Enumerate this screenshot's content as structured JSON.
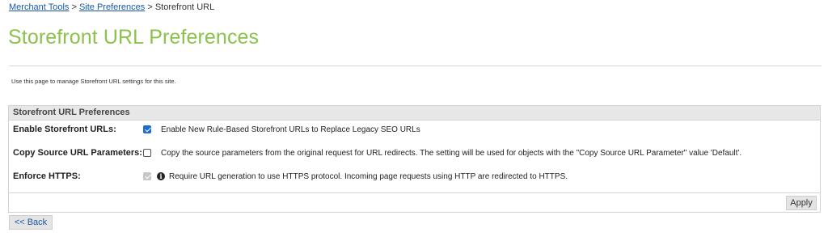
{
  "breadcrumb": {
    "items": [
      "Merchant Tools",
      "Site Preferences",
      "Storefront URL"
    ],
    "separator": ">"
  },
  "page": {
    "title": "Storefront URL Preferences",
    "intro": "Use this page to manage Storefront URL settings for this site."
  },
  "panel": {
    "header": "Storefront URL Preferences",
    "rows": [
      {
        "label": "Enable Storefront URLs:",
        "checked": true,
        "disabled": false,
        "description": "Enable New Rule-Based Storefront URLs to Replace Legacy SEO URLs"
      },
      {
        "label": "Copy Source URL Parameters:",
        "checked": false,
        "disabled": false,
        "description": "Copy the source parameters from the original request for URL redirects. The setting will be used for objects with the \"Copy Source URL Parameter\" value 'Default'."
      },
      {
        "label": "Enforce HTTPS:",
        "checked": true,
        "disabled": true,
        "info_icon": "info-circle-icon",
        "description": "Require URL generation to use HTTPS protocol. Incoming page requests using HTTP are redirected to HTTPS."
      }
    ],
    "apply_label": "Apply"
  },
  "back_label": "<< Back",
  "colors": {
    "title": "#8cc14c",
    "link": "#1a58a6",
    "checkbox": "#1c6fd1",
    "panel_header_bg": "#e7e7e7"
  }
}
